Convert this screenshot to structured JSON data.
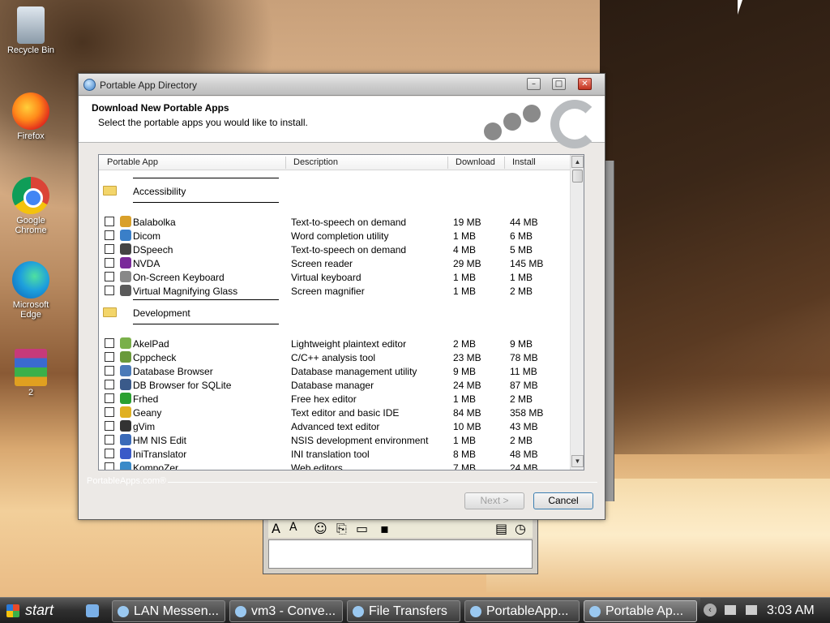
{
  "desktop": {
    "icons": [
      {
        "label": "Recycle Bin"
      },
      {
        "label": "Firefox"
      },
      {
        "label": "Google Chrome"
      },
      {
        "label": "Microsoft Edge"
      },
      {
        "label": "2"
      }
    ]
  },
  "dialog": {
    "title": "Portable App Directory",
    "header_title": "Download New Portable Apps",
    "header_subtitle": "Select the portable apps you would like to install.",
    "columns": {
      "app": "Portable App",
      "description": "Description",
      "download": "Download",
      "install": "Install"
    },
    "groups": [
      {
        "name": "Accessibility",
        "apps": [
          {
            "name": "Balabolka",
            "description": "Text-to-speech on demand",
            "download": "19 MB",
            "install": "44 MB"
          },
          {
            "name": "Dicom",
            "description": "Word completion utility",
            "download": "1 MB",
            "install": "6 MB"
          },
          {
            "name": "DSpeech",
            "description": "Text-to-speech on demand",
            "download": "4 MB",
            "install": "5 MB"
          },
          {
            "name": "NVDA",
            "description": "Screen reader",
            "download": "29 MB",
            "install": "145 MB"
          },
          {
            "name": "On-Screen Keyboard",
            "description": "Virtual keyboard",
            "download": "1 MB",
            "install": "1 MB"
          },
          {
            "name": "Virtual Magnifying Glass",
            "description": "Screen magnifier",
            "download": "1 MB",
            "install": "2 MB"
          }
        ]
      },
      {
        "name": "Development",
        "apps": [
          {
            "name": "AkelPad",
            "description": "Lightweight plaintext editor",
            "download": "2 MB",
            "install": "9 MB"
          },
          {
            "name": "Cppcheck",
            "description": "C/C++ analysis tool",
            "download": "23 MB",
            "install": "78 MB"
          },
          {
            "name": "Database Browser",
            "description": "Database management utility",
            "download": "9 MB",
            "install": "11 MB"
          },
          {
            "name": "DB Browser for SQLite",
            "description": "Database manager",
            "download": "24 MB",
            "install": "87 MB"
          },
          {
            "name": "Frhed",
            "description": "Free hex editor",
            "download": "1 MB",
            "install": "2 MB"
          },
          {
            "name": "Geany",
            "description": "Text editor and basic IDE",
            "download": "84 MB",
            "install": "358 MB"
          },
          {
            "name": "gVim",
            "description": "Advanced text editor",
            "download": "10 MB",
            "install": "43 MB"
          },
          {
            "name": "HM NIS Edit",
            "description": "NSIS development environment",
            "download": "1 MB",
            "install": "2 MB"
          },
          {
            "name": "IniTranslator",
            "description": "INI translation tool",
            "download": "8 MB",
            "install": "48 MB"
          },
          {
            "name": "KompoZer",
            "description": "Web editors",
            "download": "7 MB",
            "install": "24 MB"
          }
        ]
      }
    ],
    "footer_brand": "PortableApps.com®",
    "buttons": {
      "next": "Next >",
      "cancel": "Cancel"
    }
  },
  "taskbar": {
    "start_label": "start",
    "tasks": [
      {
        "label": "LAN Messen..."
      },
      {
        "label": "vm3 - Conve..."
      },
      {
        "label": "File Transfers"
      },
      {
        "label": "PortableApp..."
      },
      {
        "label": "Portable Ap..."
      }
    ],
    "clock": "3:03 AM"
  }
}
